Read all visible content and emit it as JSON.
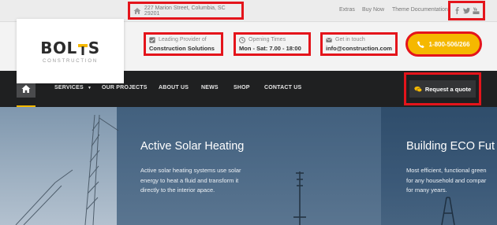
{
  "topbar": {
    "address": "227 Marion Street, Columbia, SC 29201",
    "links": [
      "Extras",
      "Buy Now",
      "Theme Documentation"
    ],
    "social_icons": [
      "facebook-icon",
      "twitter-icon",
      "youtube-icon"
    ]
  },
  "logo": {
    "name_pre": "BOL",
    "name_post": "S",
    "tagline": "CONSTRUCTION"
  },
  "header": {
    "provider": {
      "label": "Leading Provider of",
      "value": "Construction Solutions",
      "icon": "check-square-icon"
    },
    "hours": {
      "label": "Opening Times",
      "value": "Mon - Sat: 7.00 - 18:00",
      "icon": "clock-icon"
    },
    "contact": {
      "label": "Get in touch",
      "value": "info@construction.com",
      "icon": "envelope-icon"
    },
    "phone": "1-800-506/266"
  },
  "nav": {
    "items": [
      "SERVICES",
      "OUR PROJECTS",
      "ABOUT US",
      "NEWS",
      "SHOP",
      "CONTACT US"
    ],
    "quote_label": "Request a quote"
  },
  "slides": [
    {
      "title": "Active Solar Heating",
      "lines": [
        "Active solar heating systems use solar",
        "energy to heat a fluid and transform it",
        "directly to the interior apace."
      ]
    },
    {
      "title": "Building ECO Fut",
      "lines": [
        "Most efficient, functional green",
        "for any household and compar",
        "for many years."
      ]
    }
  ],
  "colors": {
    "accent": "#f5b800",
    "highlight": "#e4141b",
    "nav_bg": "#1f2021"
  }
}
